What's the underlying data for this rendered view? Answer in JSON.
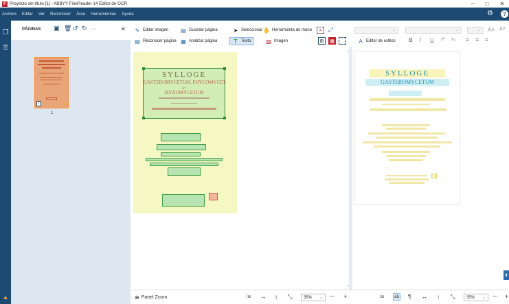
{
  "window": {
    "title": "Proyecto sin título [1] - ABBYY FineReader 14 Editor de OCR",
    "min": "–",
    "max": "□",
    "close": "✕"
  },
  "menu": [
    "Archivo",
    "Editar",
    "Ver",
    "Reconocer",
    "Área",
    "Herramientas",
    "Ayuda"
  ],
  "menu_right": {
    "settings": "⚙",
    "help": "?"
  },
  "pages": {
    "title": "PÁGINAS",
    "close": "✕",
    "more": "···",
    "thumb_number": "1"
  },
  "toolbar": {
    "edit_image": "Editar imagen",
    "save_page": "Guardar página",
    "select": "Seleccionar",
    "hand_tool": "Herramienta de mano",
    "recognize_page": "Reconocer página",
    "analyze_page": "Analizar página",
    "text": "Texto",
    "image": "Imagen",
    "style_editor": "Editor de estilos"
  },
  "page_text": {
    "t1": "SYLLOGE",
    "t2": "GASTEROMYCETUM",
    "t3": "GASTEROMYCETUM, PHYCOMYCETUM",
    "t4": "ET",
    "t5": "MYXOMYCETUM"
  },
  "status": {
    "panel_zoom": "Panel Zoom",
    "zoom_left": "35%",
    "zoom_right": "35%",
    "minus": "—",
    "plus": "+"
  },
  "colors": {
    "menubar": "#1d4a72",
    "thumb_area": "#dce7f1",
    "page_bg": "#f6f8c4",
    "block": "#3f9a45"
  }
}
